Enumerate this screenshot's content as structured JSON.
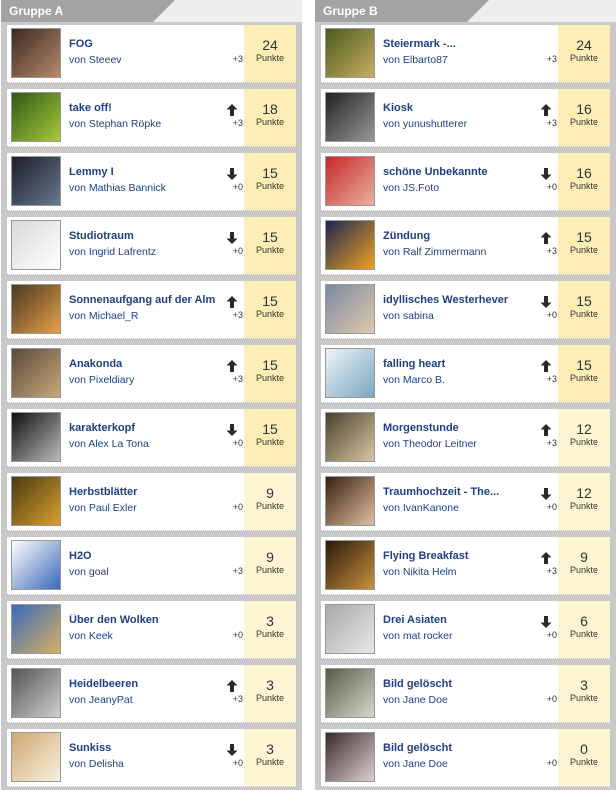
{
  "groups": [
    {
      "title": "Gruppe A",
      "entries": [
        {
          "title": "FOG",
          "author": "Steeev",
          "trend": "none",
          "delta": "+3",
          "points": "24",
          "unit": "Punkte",
          "thumb": [
            "#3a2a24",
            "#b98a6a"
          ]
        },
        {
          "title": "take off!",
          "author": "Stephan Röpke",
          "trend": "up",
          "delta": "+3",
          "points": "18",
          "unit": "Punkte",
          "thumb": [
            "#2f5a14",
            "#a8c83c"
          ]
        },
        {
          "title": "Lemmy I",
          "author": "Mathias Bannick",
          "trend": "down",
          "delta": "+0",
          "points": "15",
          "unit": "Punkte",
          "thumb": [
            "#1b1e28",
            "#6a7890"
          ]
        },
        {
          "title": "Studiotraum",
          "author": "Ingrid Lafrentz",
          "trend": "down",
          "delta": "+0",
          "points": "15",
          "unit": "Punkte",
          "thumb": [
            "#d9d9d9",
            "#ffffff"
          ]
        },
        {
          "title": "Sonnenaufgang auf der Alm",
          "author": "Michael_R",
          "trend": "up",
          "delta": "+3",
          "points": "15",
          "unit": "Punkte",
          "thumb": [
            "#4a3a20",
            "#e6a04a"
          ]
        },
        {
          "title": "Anakonda",
          "author": "Pixeldiary",
          "trend": "up",
          "delta": "+3",
          "points": "15",
          "unit": "Punkte",
          "thumb": [
            "#5a4a3a",
            "#c8a878"
          ]
        },
        {
          "title": "karakterkopf",
          "author": "Alex La Tona",
          "trend": "down",
          "delta": "+0",
          "points": "15",
          "unit": "Punkte",
          "thumb": [
            "#111111",
            "#bbbbbb"
          ]
        },
        {
          "title": "Herbstblätter",
          "author": "Paul Exler",
          "trend": "none",
          "delta": "+0",
          "points": "9",
          "unit": "Punkte",
          "thumb": [
            "#4a3a10",
            "#d8a030"
          ]
        },
        {
          "title": "H2O",
          "author": "goal",
          "trend": "none",
          "delta": "+3",
          "points": "9",
          "unit": "Punkte",
          "thumb": [
            "#ffffff",
            "#3a6ab8"
          ]
        },
        {
          "title": "Über den Wolken",
          "author": "Keek",
          "trend": "none",
          "delta": "+0",
          "points": "3",
          "unit": "Punkte",
          "thumb": [
            "#3a6ab8",
            "#d8b060"
          ]
        },
        {
          "title": "Heidelbeeren",
          "author": "JeanyPat",
          "trend": "up",
          "delta": "+3",
          "points": "3",
          "unit": "Punkte",
          "thumb": [
            "#555555",
            "#cfcfcf"
          ]
        },
        {
          "title": "Sunkiss",
          "author": "Delisha",
          "trend": "down",
          "delta": "+0",
          "points": "3",
          "unit": "Punkte",
          "thumb": [
            "#d0a870",
            "#f8f0e0"
          ]
        }
      ]
    },
    {
      "title": "Gruppe B",
      "entries": [
        {
          "title": "Steiermark -...",
          "author": "Elbarto87",
          "trend": "none",
          "delta": "+3",
          "points": "24",
          "unit": "Punkte",
          "thumb": [
            "#4a5a20",
            "#c8b060"
          ]
        },
        {
          "title": "Kiosk",
          "author": "yunushutterer",
          "trend": "up",
          "delta": "+3",
          "points": "16",
          "unit": "Punkte",
          "thumb": [
            "#222222",
            "#999999"
          ]
        },
        {
          "title": "schöne Unbekannte",
          "author": "JS.Foto",
          "trend": "down",
          "delta": "+0",
          "points": "16",
          "unit": "Punkte",
          "thumb": [
            "#c82828",
            "#e8b0a0"
          ]
        },
        {
          "title": "Zündung",
          "author": "Ralf Zimmermann",
          "trend": "up",
          "delta": "+3",
          "points": "15",
          "unit": "Punkte",
          "thumb": [
            "#1a2850",
            "#f0a020"
          ]
        },
        {
          "title": "idyllisches Westerhever",
          "author": "sabina",
          "trend": "down",
          "delta": "+0",
          "points": "15",
          "unit": "Punkte",
          "thumb": [
            "#7a8aa0",
            "#e0c8b0"
          ]
        },
        {
          "title": "falling heart",
          "author": "Marco B.",
          "trend": "up",
          "delta": "+3",
          "points": "15",
          "unit": "Punkte",
          "thumb": [
            "#eef4f8",
            "#7aa8c0"
          ]
        },
        {
          "title": "Morgenstunde",
          "author": "Theodor Leitner",
          "trend": "up",
          "delta": "+3",
          "points": "12",
          "unit": "Punkte",
          "thumb": [
            "#4a4030",
            "#d8c8a0"
          ]
        },
        {
          "title": "Traumhochzeit - The...",
          "author": "IvanKanone",
          "trend": "down",
          "delta": "+0",
          "points": "12",
          "unit": "Punkte",
          "thumb": [
            "#3a2010",
            "#e0c0a0"
          ]
        },
        {
          "title": "Flying Breakfast",
          "author": "Nikita Helm",
          "trend": "up",
          "delta": "+3",
          "points": "9",
          "unit": "Punkte",
          "thumb": [
            "#2a1a08",
            "#c89040"
          ]
        },
        {
          "title": "Drei Asiaten",
          "author": "mat rocker",
          "trend": "down",
          "delta": "+0",
          "points": "6",
          "unit": "Punkte",
          "thumb": [
            "#a8a8a8",
            "#e8e8e8"
          ]
        },
        {
          "title": "Bild gelöscht",
          "author": "Jane Doe",
          "trend": "none",
          "delta": "+0",
          "points": "3",
          "unit": "Punkte",
          "thumb": [
            "#5a5a4a",
            "#d8d8c8"
          ]
        },
        {
          "title": "Bild gelöscht",
          "author": "Jane Doe",
          "trend": "none",
          "delta": "+0",
          "points": "0",
          "unit": "Punkte",
          "thumb": [
            "#3a2a2a",
            "#e0d0d0"
          ]
        }
      ]
    }
  ],
  "author_prefix": "von"
}
